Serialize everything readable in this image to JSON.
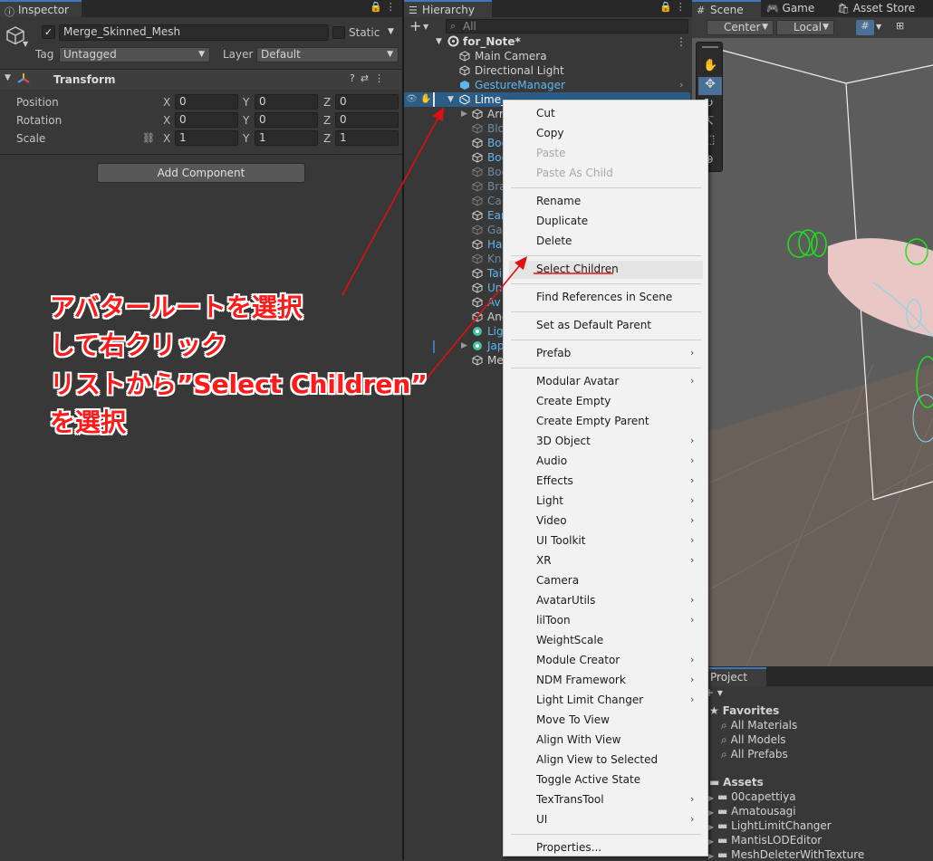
{
  "inspector": {
    "tab_label": "Inspector",
    "object_name": "Merge_Skinned_Mesh",
    "static_label": "Static",
    "tag_label": "Tag",
    "tag_value": "Untagged",
    "layer_label": "Layer",
    "layer_value": "Default",
    "transform_title": "Transform",
    "position_label": "Position",
    "rotation_label": "Rotation",
    "scale_label": "Scale",
    "axis_x": "X",
    "axis_y": "Y",
    "axis_z": "Z",
    "position": [
      "0",
      "0",
      "0"
    ],
    "rotation": [
      "0",
      "0",
      "0"
    ],
    "scale": [
      "1",
      "1",
      "1"
    ],
    "add_component": "Add Component"
  },
  "hierarchy": {
    "tab_label": "Hierarchy",
    "add_label": "+",
    "search_placeholder": "All",
    "scene_name": "for_Note*",
    "items": [
      {
        "label": "Main Camera"
      },
      {
        "label": "Directional Light"
      },
      {
        "label": "GestureManager"
      },
      {
        "label": "Lime_"
      }
    ],
    "children": [
      {
        "label": "Arr"
      },
      {
        "label": "Blo"
      },
      {
        "label": "Bod"
      },
      {
        "label": "Bod"
      },
      {
        "label": "Bod"
      },
      {
        "label": "Bra"
      },
      {
        "label": "Ca"
      },
      {
        "label": "Ear"
      },
      {
        "label": "Ga"
      },
      {
        "label": "Ha"
      },
      {
        "label": "Kn"
      },
      {
        "label": "Tai"
      },
      {
        "label": "Un"
      },
      {
        "label": "Av"
      }
    ],
    "after": [
      {
        "label": "Anc"
      },
      {
        "label": "Lig"
      },
      {
        "label": "Jap"
      },
      {
        "label": "Me"
      }
    ]
  },
  "scene_tabs": {
    "scene": "Scene",
    "game": "Game",
    "asset_store": "Asset Store",
    "center": "Center",
    "local": "Local"
  },
  "context_menu": {
    "groups": [
      [
        {
          "label": "Cut"
        },
        {
          "label": "Copy"
        },
        {
          "label": "Paste",
          "disabled": true
        },
        {
          "label": "Paste As Child",
          "disabled": true
        }
      ],
      [
        {
          "label": "Rename"
        },
        {
          "label": "Duplicate"
        },
        {
          "label": "Delete"
        }
      ],
      [
        {
          "label": "Select Children",
          "highlight": true
        }
      ],
      [
        {
          "label": "Find References in Scene"
        }
      ],
      [
        {
          "label": "Set as Default Parent"
        }
      ],
      [
        {
          "label": "Prefab",
          "sub": true
        }
      ],
      [
        {
          "label": "Modular Avatar",
          "sub": true
        },
        {
          "label": "Create Empty"
        },
        {
          "label": "Create Empty Parent"
        },
        {
          "label": "3D Object",
          "sub": true
        },
        {
          "label": "Audio",
          "sub": true
        },
        {
          "label": "Effects",
          "sub": true
        },
        {
          "label": "Light",
          "sub": true
        },
        {
          "label": "Video",
          "sub": true
        },
        {
          "label": "UI Toolkit",
          "sub": true
        },
        {
          "label": "XR",
          "sub": true
        },
        {
          "label": "Camera"
        },
        {
          "label": "AvatarUtils",
          "sub": true
        },
        {
          "label": "lilToon",
          "sub": true
        },
        {
          "label": "WeightScale"
        },
        {
          "label": "Module Creator",
          "sub": true
        },
        {
          "label": "NDM Framework",
          "sub": true
        },
        {
          "label": "Light Limit Changer",
          "sub": true
        },
        {
          "label": "Move To View"
        },
        {
          "label": "Align With View"
        },
        {
          "label": "Align View to Selected"
        },
        {
          "label": "Toggle Active State"
        },
        {
          "label": "TexTransTool",
          "sub": true
        },
        {
          "label": "UI",
          "sub": true
        }
      ],
      [
        {
          "label": "Properties..."
        }
      ]
    ]
  },
  "project": {
    "tab_label": "Project",
    "favorites_label": "Favorites",
    "favorites": [
      "All Materials",
      "All Models",
      "All Prefabs"
    ],
    "assets_label": "Assets",
    "assets": [
      "00capettiya",
      "Amatousagi",
      "LightLimitChanger",
      "MantisLODEditor",
      "MeshDeleterWithTexture"
    ]
  },
  "annotation": {
    "lines": [
      "アバタールートを選択",
      "して右クリック",
      "リストから”Select Children”",
      "を選択"
    ]
  },
  "colors": {
    "accent": "#3a79bb",
    "annotation": "#ff1a1a",
    "gizmo_green": "#19e619",
    "prefab_blue": "#5cb7f0"
  }
}
